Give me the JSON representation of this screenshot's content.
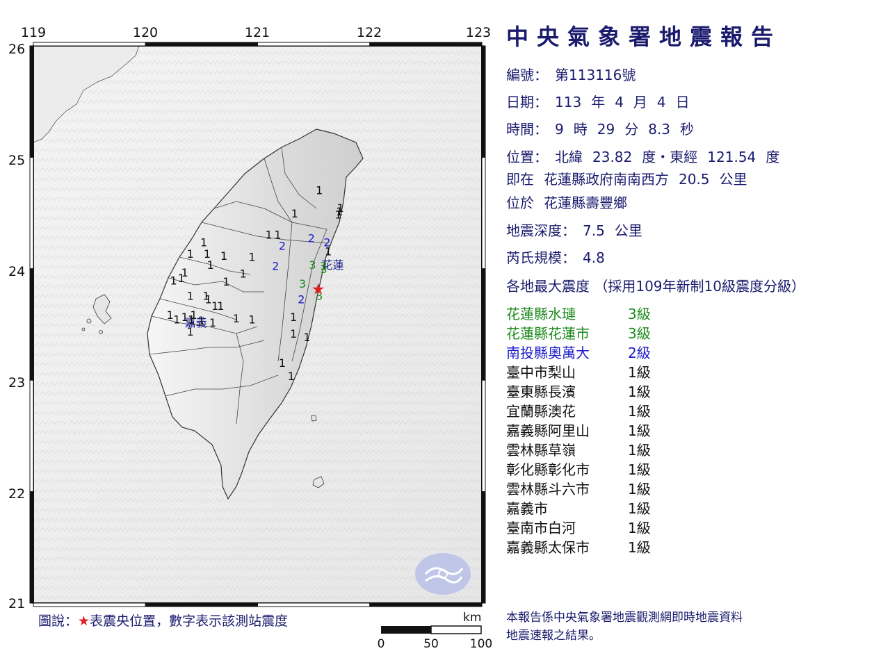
{
  "report": {
    "title": "中央氣象署地震報告",
    "number_label": "編號：",
    "number_value": "第113116號",
    "date_label": "日期：",
    "date_year": "113",
    "date_year_unit": "年",
    "date_month": "4",
    "date_month_unit": "月",
    "date_day": "4",
    "date_day_unit": "日",
    "time_label": "時間：",
    "time_hour": "9",
    "time_hour_unit": "時",
    "time_min": "29",
    "time_min_unit": "分",
    "time_sec": "8.3",
    "time_sec_unit": "秒",
    "location_label": "位置：",
    "lat_label": "北緯",
    "lat_value": "23.82",
    "lat_unit": "度",
    "lon_label": "東經",
    "lon_value": "121.54",
    "lon_unit": "度",
    "relative_prefix": "即在",
    "relative_place": "花蓮縣政府南南西方",
    "relative_dist": "20.5",
    "relative_unit": "公里",
    "within_prefix": "位於",
    "within_place": "花蓮縣壽豐鄉",
    "depth_label": "地震深度：",
    "depth_value": "7.5",
    "depth_unit": "公里",
    "magnitude_label": "芮氏規模：",
    "magnitude_value": "4.8",
    "intensity_heading": "各地最大震度 （採用109年新制10級震度分級）",
    "intensities": [
      {
        "station": "花蓮縣水璉",
        "level": "3級",
        "color": "#1a8a1a"
      },
      {
        "station": "花蓮縣花蓮市",
        "level": "3級",
        "color": "#1a8a1a"
      },
      {
        "station": "南投縣奧萬大",
        "level": "2級",
        "color": "#1a1acc"
      },
      {
        "station": "臺中市梨山",
        "level": "1級",
        "color": "#111111"
      },
      {
        "station": "臺東縣長濱",
        "level": "1級",
        "color": "#111111"
      },
      {
        "station": "宜蘭縣澳花",
        "level": "1級",
        "color": "#111111"
      },
      {
        "station": "嘉義縣阿里山",
        "level": "1級",
        "color": "#111111"
      },
      {
        "station": "雲林縣草嶺",
        "level": "1級",
        "color": "#111111"
      },
      {
        "station": "彰化縣彰化市",
        "level": "1級",
        "color": "#111111"
      },
      {
        "station": "雲林縣斗六市",
        "level": "1級",
        "color": "#111111"
      },
      {
        "station": "嘉義市",
        "level": "1級",
        "color": "#111111"
      },
      {
        "station": "臺南市白河",
        "level": "1級",
        "color": "#111111"
      },
      {
        "station": "嘉義縣太保市",
        "level": "1級",
        "color": "#111111"
      }
    ],
    "footer_line1": "本報告係中央氣象署地震觀測網即時地震資料",
    "footer_line2": "地震速報之結果。"
  },
  "map": {
    "lon_ticks": [
      "119",
      "120",
      "121",
      "122",
      "123"
    ],
    "lat_ticks": [
      "26",
      "25",
      "24",
      "23",
      "22",
      "21"
    ],
    "legend_prefix": "圖說：",
    "legend_star": "★",
    "legend_text": "表震央位置，數字表示該測站震度",
    "scale_unit": "km",
    "scale_ticks": [
      "0",
      "50",
      "100"
    ],
    "city_labels": [
      {
        "name": "花蓮",
        "lon": 121.67,
        "lat": 24.0,
        "color": "#1a1a8a"
      },
      {
        "name": "嘉義",
        "lon": 120.45,
        "lat": 23.48,
        "color": "#1a1a8a"
      }
    ],
    "epicenter": {
      "lon": 121.54,
      "lat": 23.82,
      "color": "#e02020"
    },
    "stations": [
      {
        "v": "1",
        "lon": 121.55,
        "lat": 24.67
      },
      {
        "v": "1",
        "lon": 121.74,
        "lat": 24.51
      },
      {
        "v": "1",
        "lon": 121.73,
        "lat": 24.48
      },
      {
        "v": "1",
        "lon": 121.72,
        "lat": 24.45
      },
      {
        "v": "1",
        "lon": 121.33,
        "lat": 24.46
      },
      {
        "v": "1",
        "lon": 121.1,
        "lat": 24.27
      },
      {
        "v": "1",
        "lon": 121.18,
        "lat": 24.27
      },
      {
        "v": "2",
        "lon": 121.48,
        "lat": 24.24,
        "c": "#1a1acc"
      },
      {
        "v": "2",
        "lon": 121.62,
        "lat": 24.2,
        "c": "#1a1acc"
      },
      {
        "v": "2",
        "lon": 121.22,
        "lat": 24.17,
        "c": "#1a1acc"
      },
      {
        "v": "1",
        "lon": 121.63,
        "lat": 24.12
      },
      {
        "v": "2",
        "lon": 121.16,
        "lat": 23.99,
        "c": "#1a1acc"
      },
      {
        "v": "3",
        "lon": 121.49,
        "lat": 24.0,
        "c": "#1a8a1a"
      },
      {
        "v": "3",
        "lon": 121.59,
        "lat": 23.99,
        "c": "#1a8a1a"
      },
      {
        "v": "3",
        "lon": 121.59,
        "lat": 23.96,
        "c": "#1a8a1a"
      },
      {
        "v": "3",
        "lon": 121.4,
        "lat": 23.83,
        "c": "#1a8a1a"
      },
      {
        "v": "2",
        "lon": 121.39,
        "lat": 23.69,
        "c": "#1a1acc"
      },
      {
        "v": "3",
        "lon": 121.55,
        "lat": 23.72,
        "c": "#1a8a1a"
      },
      {
        "v": "1",
        "lon": 120.52,
        "lat": 24.2
      },
      {
        "v": "1",
        "lon": 120.4,
        "lat": 24.1
      },
      {
        "v": "1",
        "lon": 120.55,
        "lat": 24.1
      },
      {
        "v": "1",
        "lon": 120.7,
        "lat": 24.08
      },
      {
        "v": "1",
        "lon": 120.95,
        "lat": 24.07
      },
      {
        "v": "1",
        "lon": 120.58,
        "lat": 24.0
      },
      {
        "v": "1",
        "lon": 120.35,
        "lat": 23.93
      },
      {
        "v": "1",
        "lon": 120.25,
        "lat": 23.86
      },
      {
        "v": "1",
        "lon": 120.32,
        "lat": 23.88
      },
      {
        "v": "1",
        "lon": 120.87,
        "lat": 23.92
      },
      {
        "v": "1",
        "lon": 120.72,
        "lat": 23.85
      },
      {
        "v": "1",
        "lon": 120.4,
        "lat": 23.72
      },
      {
        "v": "1",
        "lon": 120.54,
        "lat": 23.72
      },
      {
        "v": "1",
        "lon": 120.56,
        "lat": 23.69
      },
      {
        "v": "1",
        "lon": 120.62,
        "lat": 23.63
      },
      {
        "v": "1",
        "lon": 120.67,
        "lat": 23.63
      },
      {
        "v": "1",
        "lon": 120.22,
        "lat": 23.55
      },
      {
        "v": "1",
        "lon": 120.28,
        "lat": 23.51
      },
      {
        "v": "1",
        "lon": 120.35,
        "lat": 23.53
      },
      {
        "v": "1",
        "lon": 120.43,
        "lat": 23.55
      },
      {
        "v": "1",
        "lon": 120.5,
        "lat": 23.5
      },
      {
        "v": "1",
        "lon": 120.41,
        "lat": 23.51
      },
      {
        "v": "1",
        "lon": 120.6,
        "lat": 23.48
      },
      {
        "v": "1",
        "lon": 120.81,
        "lat": 23.52
      },
      {
        "v": "1",
        "lon": 120.95,
        "lat": 23.51
      },
      {
        "v": "1",
        "lon": 121.32,
        "lat": 23.53
      },
      {
        "v": "1",
        "lon": 120.4,
        "lat": 23.4
      },
      {
        "v": "1",
        "lon": 121.32,
        "lat": 23.38
      },
      {
        "v": "1",
        "lon": 121.44,
        "lat": 23.35
      },
      {
        "v": "1",
        "lon": 121.22,
        "lat": 23.12
      },
      {
        "v": "1",
        "lon": 121.3,
        "lat": 23.0
      }
    ]
  }
}
